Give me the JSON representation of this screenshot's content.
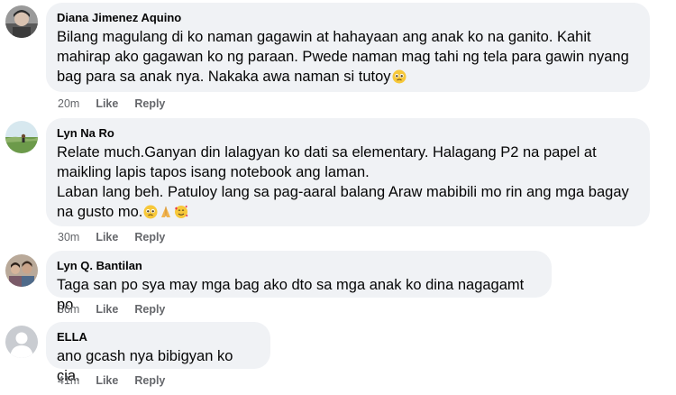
{
  "comments": [
    {
      "author": "Diana Jimenez Aquino",
      "text": "Bilang magulang di ko naman gagawin at hahayaan ang anak ko na ganito. Kahit\nmahirap ako gagawan ko ng paraan. Pwede naman mag tahi ng tela para gawin nyang\nbag para sa anak nya. Nakaka awa naman si tutoy",
      "emojis": [
        "crying-face"
      ],
      "time": "20m",
      "like_label": "Like",
      "reply_label": "Reply"
    },
    {
      "author": "Lyn Na Ro",
      "text": "Relate much.Ganyan din lalagyan ko dati sa elementary. Halagang P2 na papel at\nmaikling lapis tapos isang notebook ang laman.\nLaban lang beh. Patuloy lang sa pag-aaral balang Araw mabibili mo rin ang mga bagay\nna gusto mo.",
      "emojis": [
        "crying-face",
        "folded-hands",
        "smiling-hearts-face"
      ],
      "time": "30m",
      "like_label": "Like",
      "reply_label": "Reply"
    },
    {
      "author": "Lyn Q. Bantilan",
      "text": "Taga san po sya may mga bag ako dto sa mga anak ko dina nagagamt po",
      "emojis": [],
      "time": "36m",
      "like_label": "Like",
      "reply_label": "Reply"
    },
    {
      "author": "ELLA",
      "text": "ano gcash nya bibigyan ko cia.",
      "emojis": [],
      "time": "41m",
      "like_label": "Like",
      "reply_label": "Reply"
    }
  ],
  "colors": {
    "bubble": "#f0f2f5",
    "text": "#050505",
    "meta": "#65676b"
  }
}
